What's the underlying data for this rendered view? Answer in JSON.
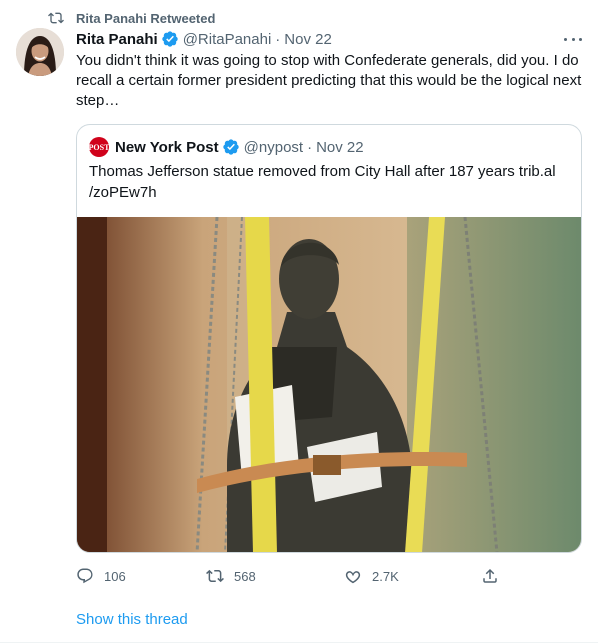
{
  "retweet_banner": {
    "icon": "retweet-icon",
    "text": "Rita Panahi Retweeted"
  },
  "tweet": {
    "author": {
      "display_name": "Rita Panahi",
      "handle": "@RitaPanahi",
      "verified": true,
      "avatar_icon": "avatar-photo"
    },
    "separator": "·",
    "date": "Nov 22",
    "text": "You didn't think it was going to stop with Confederate generals, did you. I do recall a certain former president predicting that this would be the logical next step…",
    "more_icon": "more-options-icon"
  },
  "quoted_tweet": {
    "author": {
      "display_name": "New York Post",
      "handle": "@nypost",
      "verified": true,
      "logo_text": "POST"
    },
    "separator": "·",
    "date": "Nov 22",
    "text": "Thomas Jefferson statue removed from City Hall after 187 years trib.al /zoPEw7h",
    "image_icon": "statue-photo"
  },
  "actions": {
    "reply_count": "106",
    "retweet_count": "568",
    "like_count": "2.7K",
    "reply_icon": "reply-icon",
    "retweet_icon": "retweet-icon",
    "like_icon": "heart-icon",
    "share_icon": "share-icon"
  },
  "show_thread": "Show this thread",
  "colors": {
    "accent": "#1d9bf0",
    "secondary_text": "#536471",
    "primary_text": "#0f1419",
    "border": "#cfd9de",
    "nypost_red": "#d0021b"
  }
}
